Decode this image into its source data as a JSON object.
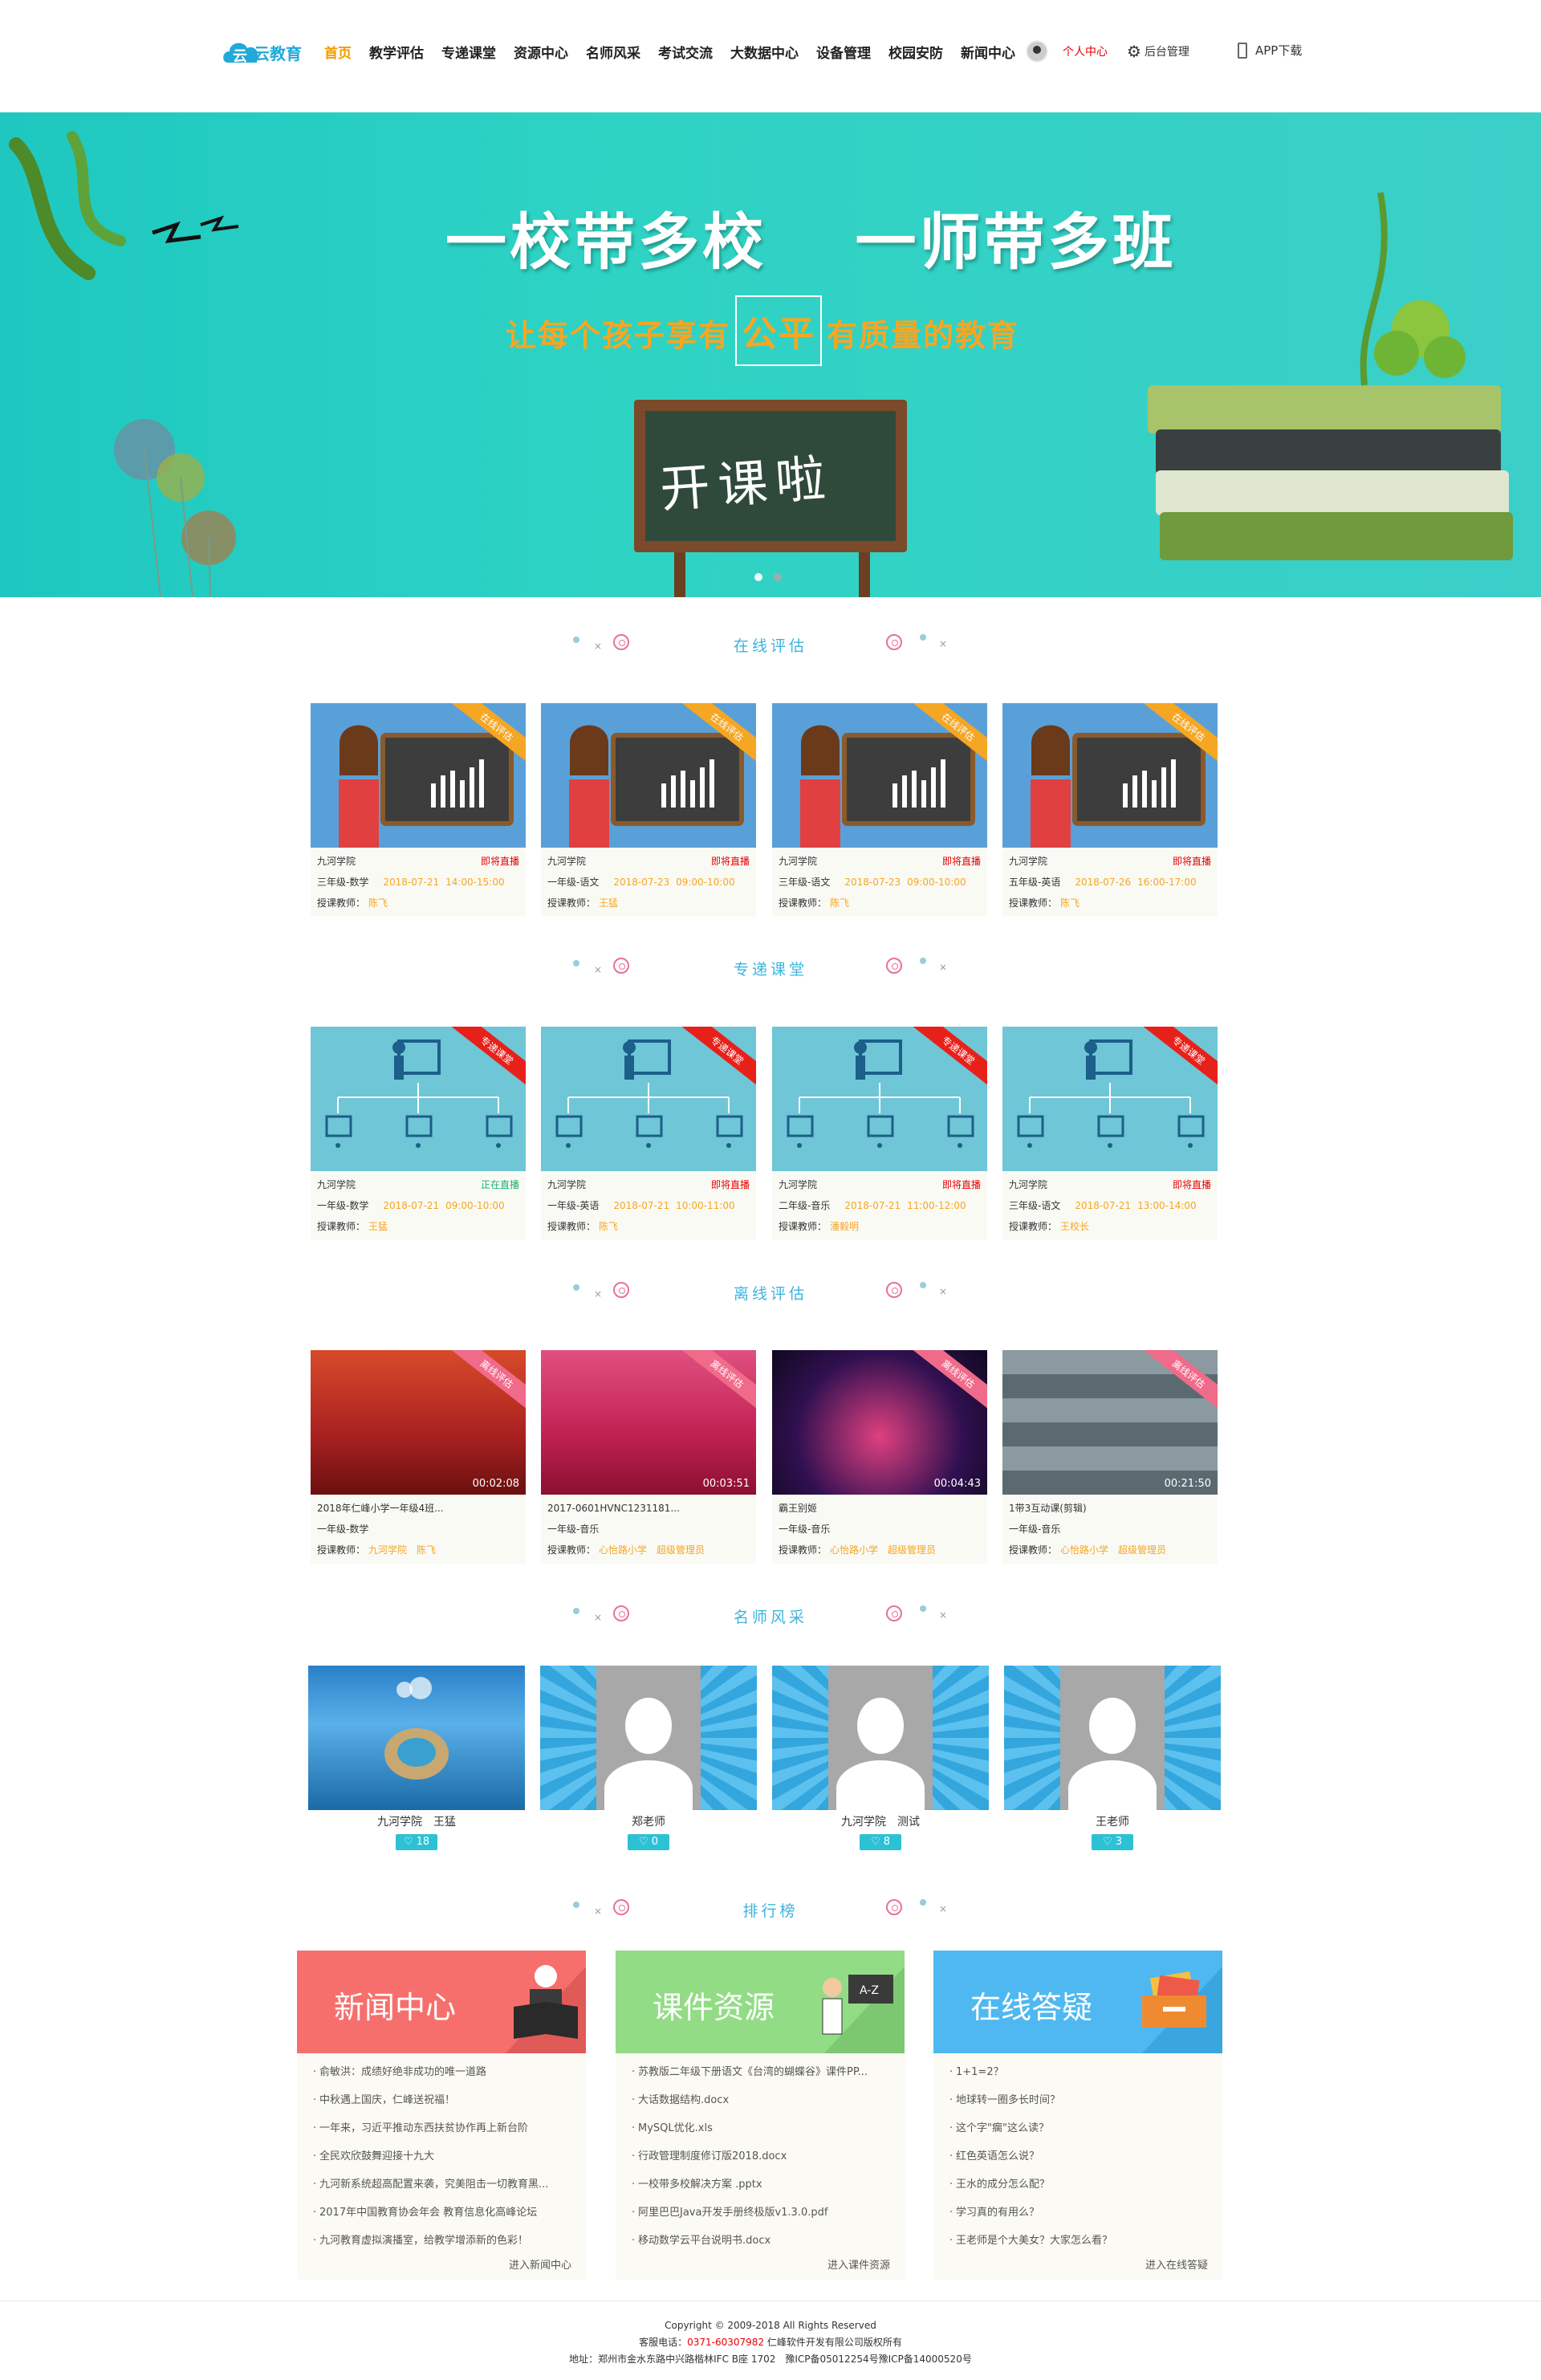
{
  "header": {
    "logo_text": "云教育",
    "nav": [
      "首页",
      "教学评估",
      "专递课堂",
      "资源中心",
      "名师风采",
      "考试交流",
      "大数据中心",
      "设备管理",
      "校园安防",
      "新闻中心"
    ],
    "user_center": "个人中心",
    "admin": "后台管理",
    "app_download": "APP下载"
  },
  "banner": {
    "line1": "一校带多校　 一师带多班",
    "line2_pre": "让每个孩子享有",
    "line2_hl": "公平",
    "line2_post": "有质量的教育",
    "board_text": "开课啦"
  },
  "sections": {
    "online": "在线评估",
    "relay": "专递课堂",
    "offline": "离线评估",
    "teachers": "名师风采",
    "ranking": "排行榜"
  },
  "online_cards": [
    {
      "ribbon": "在线评估",
      "school": "九河学院",
      "status": "即将直播",
      "grade": "三年级-数学",
      "date": "2018-07-21",
      "time": "14:00-15:00",
      "teacher_label": "授课教师：",
      "teacher": "陈飞"
    },
    {
      "ribbon": "在线评估",
      "school": "九河学院",
      "status": "即将直播",
      "grade": "一年级-语文",
      "date": "2018-07-23",
      "time": "09:00-10:00",
      "teacher_label": "授课教师：",
      "teacher": "王猛"
    },
    {
      "ribbon": "在线评估",
      "school": "九河学院",
      "status": "即将直播",
      "grade": "三年级-语文",
      "date": "2018-07-23",
      "time": "09:00-10:00",
      "teacher_label": "授课教师：",
      "teacher": "陈飞"
    },
    {
      "ribbon": "在线评估",
      "school": "九河学院",
      "status": "即将直播",
      "grade": "五年级-英语",
      "date": "2018-07-26",
      "time": "16:00-17:00",
      "teacher_label": "授课教师：",
      "teacher": "陈飞"
    }
  ],
  "relay_cards": [
    {
      "ribbon": "专递课堂",
      "school": "九河学院",
      "status": "正在直播",
      "grade": "一年级-数学",
      "date": "2018-07-21",
      "time": "09:00-10:00",
      "teacher_label": "授课教师：",
      "teacher": "王猛"
    },
    {
      "ribbon": "专递课堂",
      "school": "九河学院",
      "status": "即将直播",
      "grade": "一年级-英语",
      "date": "2018-07-21",
      "time": "10:00-11:00",
      "teacher_label": "授课教师：",
      "teacher": "陈飞"
    },
    {
      "ribbon": "专递课堂",
      "school": "九河学院",
      "status": "即将直播",
      "grade": "二年级-音乐",
      "date": "2018-07-21",
      "time": "11:00-12:00",
      "teacher_label": "授课教师：",
      "teacher": "潘毅明"
    },
    {
      "ribbon": "专递课堂",
      "school": "九河学院",
      "status": "即将直播",
      "grade": "三年级-语文",
      "date": "2018-07-21",
      "time": "13:00-14:00",
      "teacher_label": "授课教师：",
      "teacher": "王校长"
    }
  ],
  "offline_cards": [
    {
      "ribbon": "离线评估",
      "title": "2018年仁峰小学一年级4班...",
      "duration": "00:02:08",
      "grade": "一年级-数学",
      "teacher_label": "授课教师：",
      "teacher": "九河学院　陈飞"
    },
    {
      "ribbon": "离线评估",
      "title": "2017-0601HVNC1231181...",
      "duration": "00:03:51",
      "grade": "一年级-音乐",
      "teacher_label": "授课教师：",
      "teacher": "心怡路小学　超级管理员"
    },
    {
      "ribbon": "离线评估",
      "title": "霸王别姬",
      "duration": "00:04:43",
      "grade": "一年级-音乐",
      "teacher_label": "授课教师：",
      "teacher": "心怡路小学　超级管理员"
    },
    {
      "ribbon": "离线评估",
      "title": "1带3互动课(剪辑)",
      "duration": "00:21:50",
      "grade": "一年级-音乐",
      "teacher_label": "授课教师：",
      "teacher": "心怡路小学　超级管理员"
    }
  ],
  "teachers": [
    {
      "name": "九河学院　王猛",
      "count": "18"
    },
    {
      "name": "郑老师",
      "count": "0"
    },
    {
      "name": "九河学院　测试",
      "count": "8"
    },
    {
      "name": "王老师",
      "count": "3"
    }
  ],
  "panels": {
    "news": {
      "title": "新闻中心",
      "color": "#f76f6c",
      "more": "进入新闻中心",
      "items": [
        "俞敏洪：成绩好绝非成功的唯一道路",
        "中秋遇上国庆，仁峰送祝福！",
        "一年来，习近平推动东西扶贫协作再上新台阶",
        "全民欢欣鼓舞迎接十九大",
        "九河新系统超高配置来袭，究美阻击一切教育黑...",
        "2017年中国教育协会年会 教育信息化高峰论坛",
        "九河教育虚拟演播室，给教学增添新的色彩！"
      ]
    },
    "courseware": {
      "title": "课件资源",
      "color": "#93dc86",
      "more": "进入课件资源",
      "items": [
        "苏教版二年级下册语文《台湾的蝴蝶谷》课件PP...",
        "大话数据结构.docx",
        "MySQL优化.xls",
        "行政管理制度修订版2018.docx",
        "一校带多校解决方案 .pptx",
        "阿里巴巴Java开发手册终极版v1.3.0.pdf",
        "移动数学云平台说明书.docx"
      ]
    },
    "qa": {
      "title": "在线答疑",
      "color": "#4fb8f0",
      "more": "进入在线答疑",
      "items": [
        "1+1=2？",
        "地球转一圈多长时间？",
        "这个字\"瘸\"这么读？",
        "红色英语怎么说？",
        "王水的成分怎么配？",
        "学习真的有用么？",
        "王老师是个大美女？大家怎么看？"
      ]
    }
  },
  "footer": {
    "copyright": "Copyright © 2009-2018 All Rights Reserved",
    "hotline_label": "客服电话：",
    "hotline": "0371-60307982",
    "company": "仁峰软件开发有限公司版权所有",
    "address": "地址：郑州市金水东路中兴路楷林IFC B座 1702　豫ICP备05012254号豫ICP备14000520号"
  },
  "colors": {
    "accent": "#f19c00",
    "teal": "#2ed3c4",
    "title_blue": "#3cb4dc"
  }
}
